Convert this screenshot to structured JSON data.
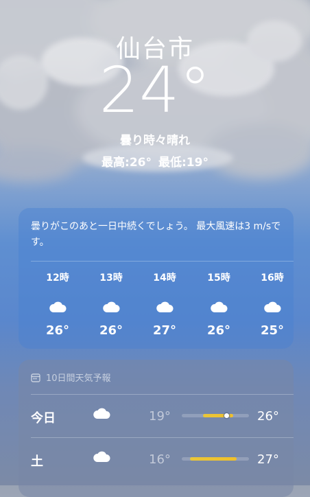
{
  "hero": {
    "city": "仙台市",
    "temperature": "24°",
    "condition": "曇り時々晴れ",
    "high": "最高:26°",
    "low": "最低:19°"
  },
  "hourly": {
    "summary": "曇りがこのあと一日中続くでしょう。 最大風速は3 m/sです。",
    "items": [
      {
        "hour": "12時",
        "icon": "cloud-icon",
        "temp": "26°"
      },
      {
        "hour": "13時",
        "icon": "cloud-icon",
        "temp": "26°"
      },
      {
        "hour": "14時",
        "icon": "cloud-icon",
        "temp": "27°"
      },
      {
        "hour": "15時",
        "icon": "cloud-icon",
        "temp": "26°"
      },
      {
        "hour": "16時",
        "icon": "cloud-icon",
        "temp": "25°"
      }
    ]
  },
  "daily": {
    "header": "10日間天気予報",
    "header_icon": "calendar-icon",
    "rows": [
      {
        "day": "今日",
        "icon": "cloud-icon",
        "low": "19°",
        "high": "26°",
        "range_start": 0.32,
        "range_end": 0.77,
        "current": 0.67
      },
      {
        "day": "土",
        "icon": "cloud-icon",
        "low": "16°",
        "high": "27°",
        "range_start": 0.12,
        "range_end": 0.82
      }
    ]
  },
  "colors": {
    "sky_top": "#9aa3b4",
    "sky_mid": "#5f8fd1",
    "temp_bar": "#f0c02a"
  }
}
